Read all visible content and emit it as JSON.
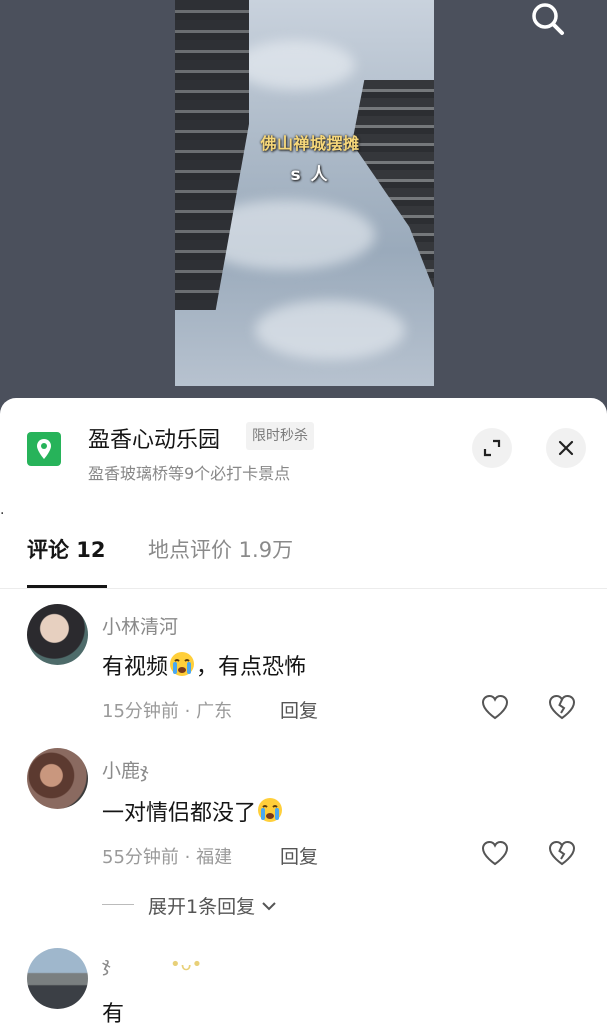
{
  "video": {
    "caption_line1": "佛山禅城摆摊",
    "caption_line2": "s 人",
    "search_icon": "search-icon"
  },
  "location": {
    "icon": "location-pin-icon",
    "name": "盈香心动乐园",
    "tag": "限时秒杀",
    "subtitle": "盈香玻璃桥等9个必打卡景点",
    "expand_icon": "expand-icon",
    "close_icon": "close-icon"
  },
  "tabs": [
    {
      "label": "评论 12",
      "active": true
    },
    {
      "label": "地点评价 1.9万",
      "active": false
    }
  ],
  "comments": [
    {
      "username": "小林清河",
      "text": "有视频",
      "text_after_emoji": "，有点恐怖",
      "emoji": "crying-face",
      "time": "15分钟前 · 广东",
      "reply_label": "回复"
    },
    {
      "username": "小鹿ჯ",
      "text": "一对情侣都没了",
      "emoji": "crying-face",
      "time": "55分钟前 · 福建",
      "reply_label": "回复",
      "expand_replies": "展开1条回复"
    },
    {
      "username": "ჯ",
      "text": "有"
    }
  ],
  "colors": {
    "accent_green": "#27b35a",
    "text_primary": "#151515",
    "text_secondary": "#8a8a8a"
  }
}
